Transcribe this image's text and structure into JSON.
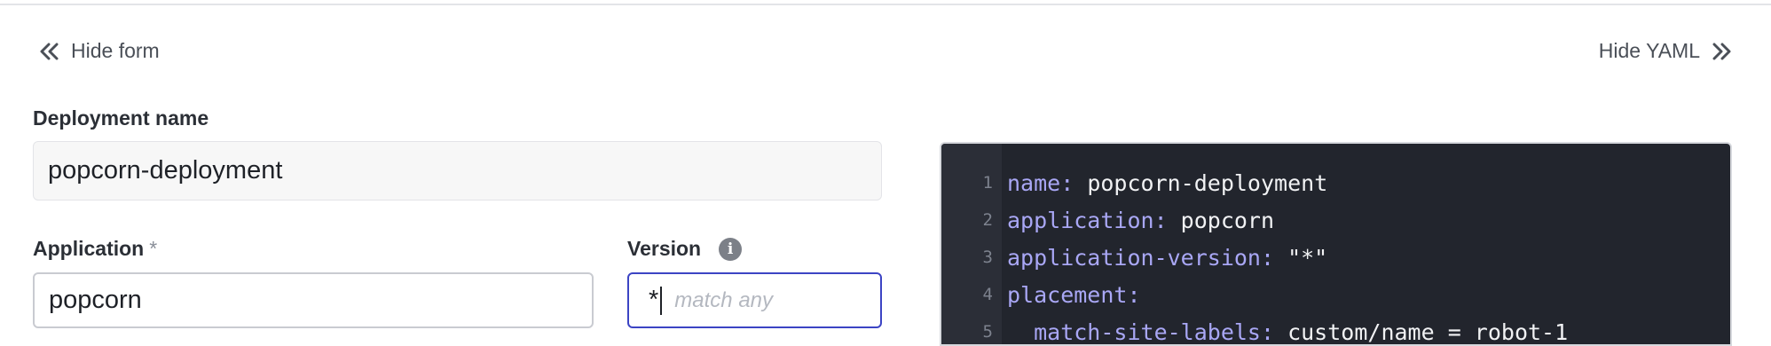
{
  "toolbar": {
    "hide_form": "Hide form",
    "hide_yaml": "Hide YAML"
  },
  "form": {
    "deployment_name_label": "Deployment name",
    "deployment_name_value": "popcorn-deployment",
    "application_label": "Application",
    "application_required": "*",
    "application_value": "popcorn",
    "version_label": "Version",
    "version_value": "*",
    "version_placeholder": "match any",
    "info_icon_glyph": "i"
  },
  "yaml": {
    "lines": [
      {
        "num": "1",
        "key": "name:",
        "value": " popcorn-deployment"
      },
      {
        "num": "2",
        "key": "application:",
        "value": " popcorn"
      },
      {
        "num": "3",
        "key": "application-version:",
        "value": " \"*\""
      },
      {
        "num": "4",
        "key": "placement:",
        "value": ""
      },
      {
        "num": "5",
        "key": "  match-site-labels:",
        "value": " custom/name = robot-1"
      }
    ]
  },
  "colors": {
    "accent": "#3c44c4",
    "editor_bg": "#22252d",
    "yaml_key": "#a9a7f5"
  }
}
